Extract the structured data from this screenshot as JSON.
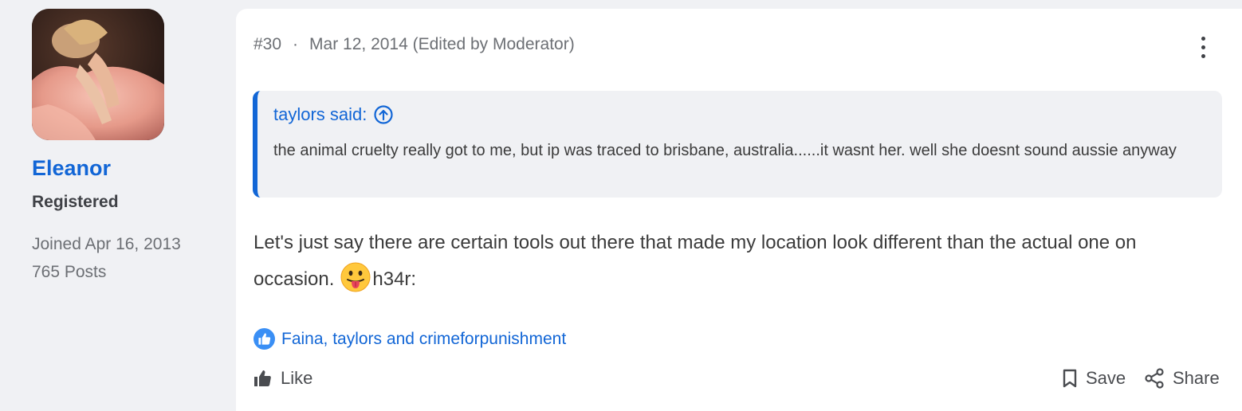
{
  "author": {
    "name": "Eleanor",
    "role": "Registered",
    "joined": "Joined Apr 16, 2013",
    "posts": "765 Posts"
  },
  "post": {
    "number": "#30",
    "separator": "·",
    "date": "Mar 12, 2014 (Edited by Moderator)",
    "quote": {
      "author": "taylors said:",
      "text": "the animal cruelty really got to me, but ip was traced to brisbane, australia......it wasnt her. well she doesnt sound aussie anyway"
    },
    "body_text": "Let's just say there are certain tools out there that made my location look different than the actual one on occasion.",
    "body_suffix": "h34r:",
    "emoji": "tongue-out-face",
    "reactions": "Faina, taylors and crimeforpunishment"
  },
  "actions": {
    "like": "Like",
    "save": "Save",
    "share": "Share"
  },
  "colors": {
    "accent": "#1266d6",
    "background": "#f0f1f4",
    "card": "#ffffff"
  }
}
